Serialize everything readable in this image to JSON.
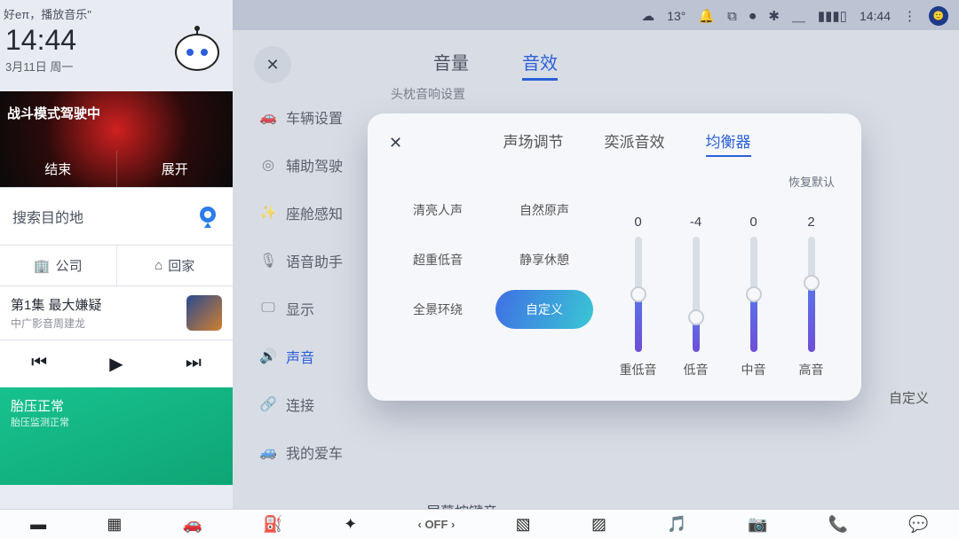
{
  "statusbar": {
    "weather_icon": "cloud-icon",
    "temp": "13°",
    "bell_icon": "bell-icon",
    "dashcam_icon": "dashcam-icon",
    "screen_icon": "screenrec-icon",
    "bt_icon": "bluetooth-icon",
    "range_icon": "range-icon",
    "signal_icon": "signal-icon",
    "time": "14:44",
    "more": "⋮"
  },
  "left": {
    "voice_tip": "好eπ，播放音乐\"",
    "clock": "14:44",
    "date": "3月11日 周一",
    "drive_title": "战斗模式驾驶中",
    "drive_end": "结束",
    "drive_expand": "展开",
    "search_placeholder": "搜索目的地",
    "shortcut_company": "公司",
    "shortcut_home": "回家",
    "media_title": "第1集 最大嫌疑",
    "media_sub": "中广影音周建龙",
    "tire_title": "胎压正常",
    "tire_sub": "胎压监测正常"
  },
  "settings": {
    "close": "✕",
    "tabs": {
      "volume": "音量",
      "effects": "音效"
    },
    "active_tab": "effects",
    "nav": [
      {
        "icon": "🚗",
        "label": "车辆设置"
      },
      {
        "icon": "◎",
        "label": "辅助驾驶"
      },
      {
        "icon": "✨",
        "label": "座舱感知"
      },
      {
        "icon": "🎙",
        "label": "语音助手"
      },
      {
        "icon": "🖵",
        "label": "显示"
      },
      {
        "icon": "🔊",
        "label": "声音"
      },
      {
        "icon": "🔗",
        "label": "连接"
      },
      {
        "icon": "🚙",
        "label": "我的爱车"
      }
    ],
    "nav_selected_index": 5,
    "headrest_label": "头枕音响设置",
    "custom_label": "自定义",
    "keytone_label": "屏幕按键音"
  },
  "eq": {
    "close": "✕",
    "tabs": {
      "field": "声场调节",
      "yipai": "奕派音效",
      "equalizer": "均衡器"
    },
    "active_tab": "equalizer",
    "presets": [
      "清亮人声",
      "自然原声",
      "超重低音",
      "静享休憩",
      "全景环绕",
      "自定义"
    ],
    "active_preset_index": 5,
    "reset": "恢复默认",
    "bands": [
      {
        "name": "重低音",
        "value": 0
      },
      {
        "name": "低音",
        "value": -4
      },
      {
        "name": "中音",
        "value": 0
      },
      {
        "name": "高音",
        "value": 2
      }
    ],
    "band_range": {
      "min": -10,
      "max": 10
    }
  },
  "dock": {
    "items": [
      "home",
      "apps",
      "car",
      "fuel",
      "fan",
      "‹ OFF ›",
      "defrost-front",
      "defrost-rear",
      "music",
      "camera",
      "phone",
      "assistant"
    ]
  }
}
